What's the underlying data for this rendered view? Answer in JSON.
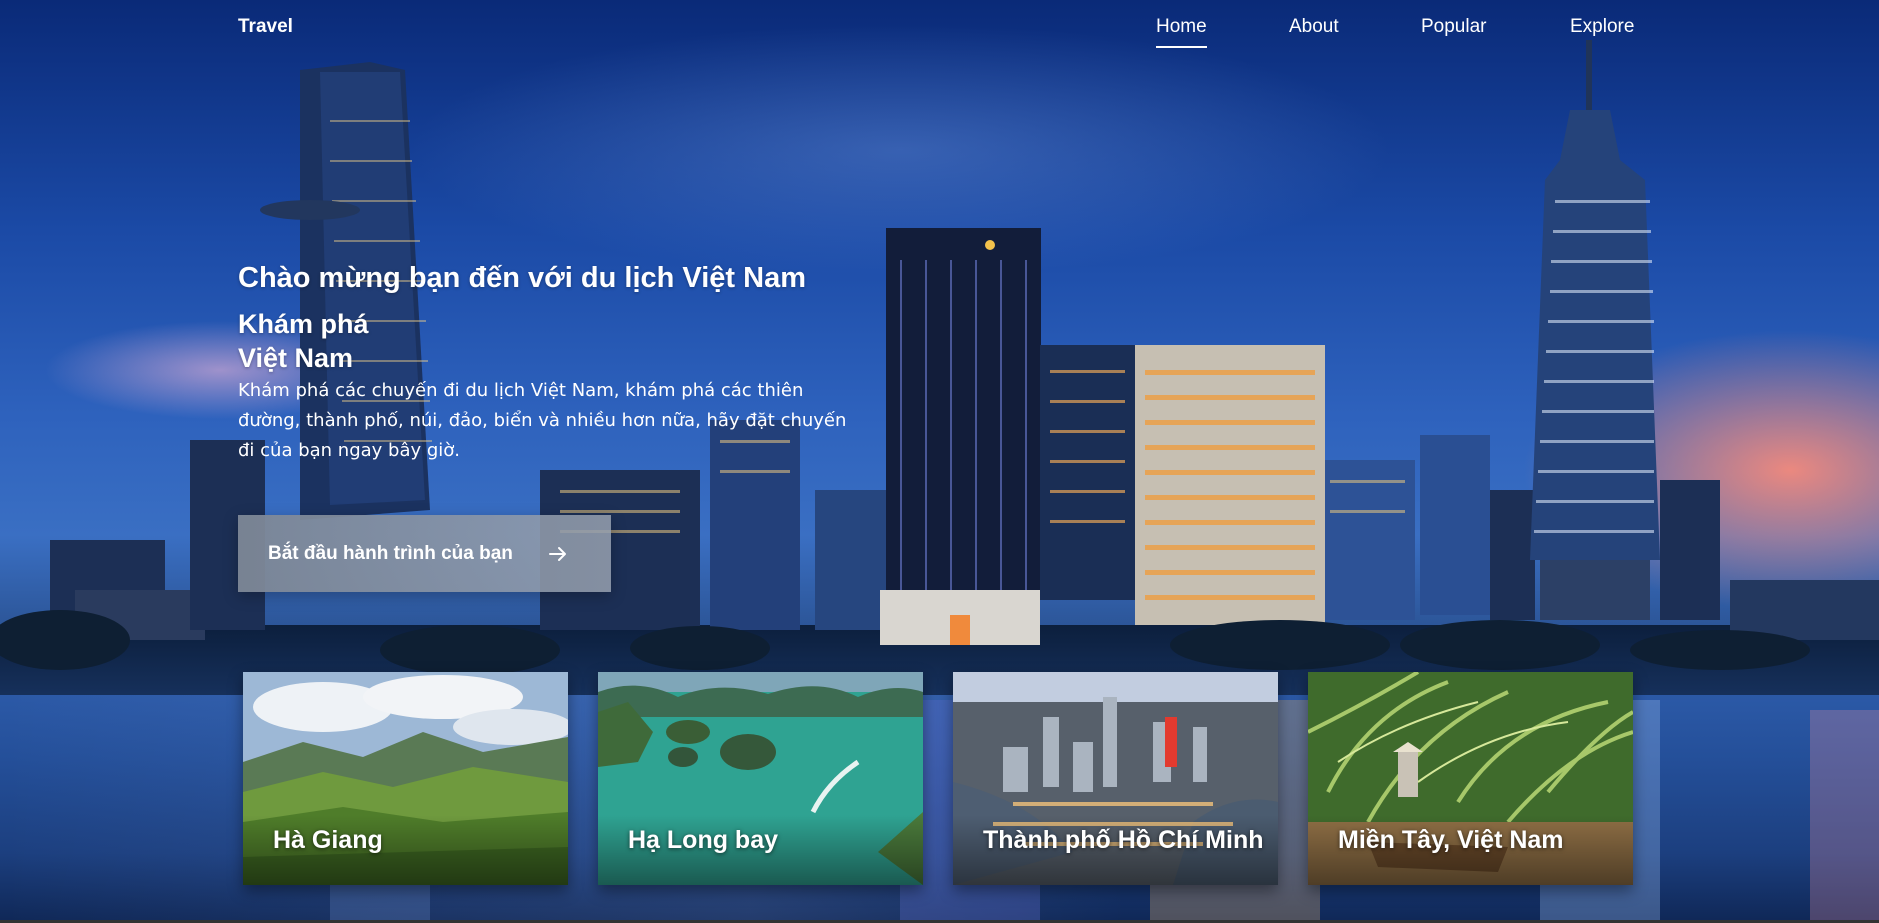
{
  "nav": {
    "logo": "Travel",
    "items": [
      {
        "label": "Home",
        "active": true
      },
      {
        "label": "About",
        "active": false
      },
      {
        "label": "Popular",
        "active": false
      },
      {
        "label": "Explore",
        "active": false
      }
    ]
  },
  "hero": {
    "welcome": "Chào mừng bạn đến với du lịch Việt Nam",
    "title_line1": "Khám phá",
    "title_line2": "Việt Nam",
    "description": "Khám phá các chuyến đi du lịch Việt Nam, khám phá các thiên đường, thành phố, núi, đảo, biển và nhiều hơn nữa, hãy đặt chuyến đi của bạn ngay bây giờ.",
    "cta_label": "Bắt đầu hành trình của bạn",
    "cta_icon": "arrow-right-icon"
  },
  "cards": [
    {
      "label": "Hà Giang",
      "image": "mountain-valley-image"
    },
    {
      "label": "Hạ Long bay",
      "image": "bay-islands-image"
    },
    {
      "label": "Thành phố Hồ Chí Minh",
      "image": "city-aerial-image"
    },
    {
      "label": "Miền Tây, Việt Nam",
      "image": "palm-river-boat-image"
    }
  ],
  "colors": {
    "sky_top": "#0a2a78",
    "sky_mid": "#2e62bd",
    "cta_bg": "#7d8796",
    "text": "#ffffff"
  }
}
